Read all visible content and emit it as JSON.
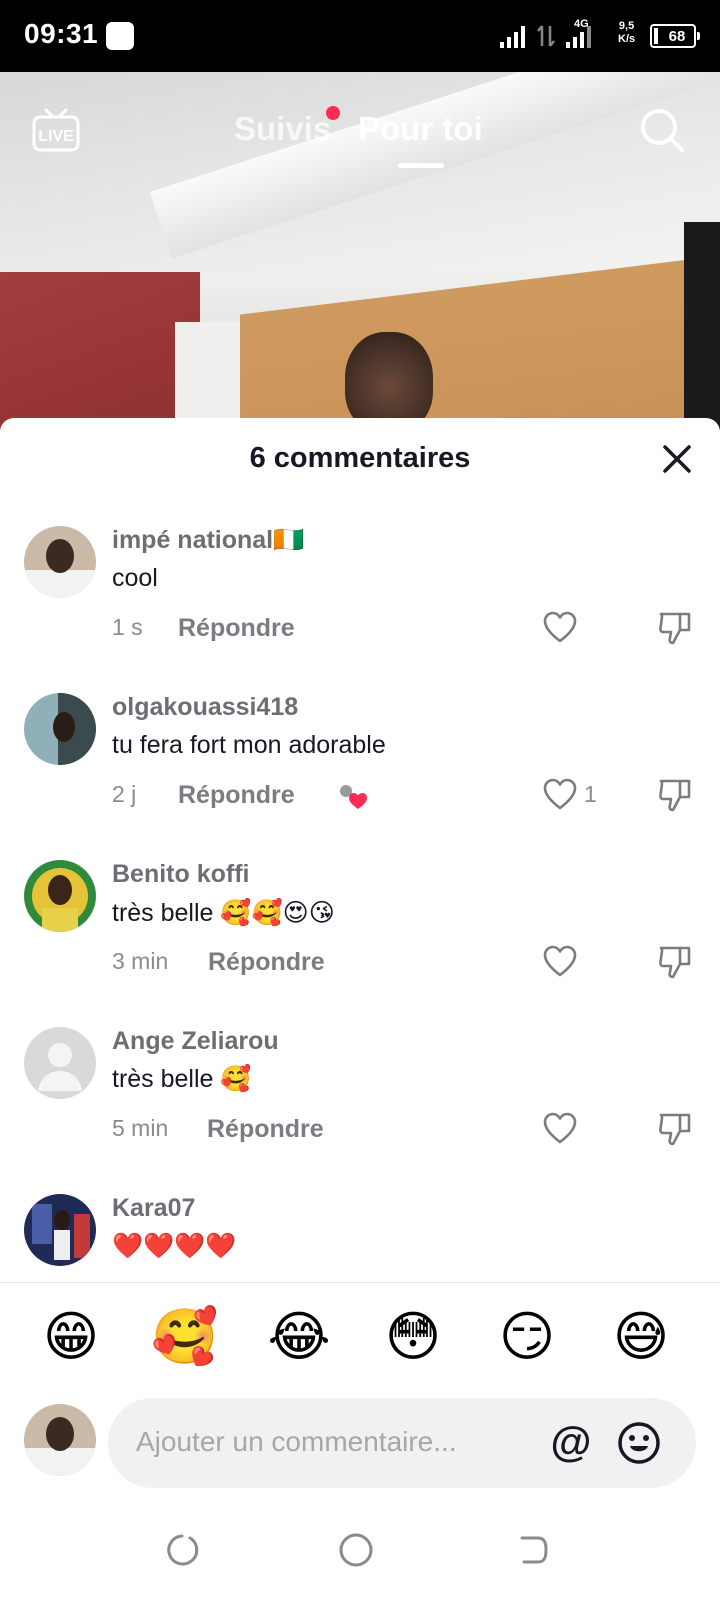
{
  "status_bar": {
    "time": "09:31",
    "network": "4G",
    "speed_value": "9,5",
    "speed_unit": "K/s",
    "battery": "68"
  },
  "top_nav": {
    "live_label": "LIVE",
    "tab_following": "Suivis",
    "tab_for_you": "Pour toi",
    "active_tab": "Pour toi"
  },
  "sheet": {
    "title": "6 commentaires",
    "reply_label": "Répondre",
    "comments": [
      {
        "user": "impé national🇨🇮",
        "text": "cool",
        "time": "1 s",
        "likes": "",
        "creator_liked": false
      },
      {
        "user": "olgakouassi418",
        "text": "tu fera fort mon adorable",
        "time": "2 j",
        "likes": "1",
        "creator_liked": true
      },
      {
        "user": "Benito koffi",
        "text": "très belle 🥰🥰😍😘",
        "time": "3 min",
        "likes": "",
        "creator_liked": false
      },
      {
        "user": "Ange Zeliarou",
        "text": "très belle 🥰",
        "time": "5 min",
        "likes": "",
        "creator_liked": false
      },
      {
        "user": "Kara07",
        "text": "❤️❤️❤️❤️",
        "time": "",
        "likes": "",
        "creator_liked": false
      }
    ]
  },
  "quick_emojis": [
    "😁",
    "🥰",
    "😂",
    "😳",
    "😏",
    "😅"
  ],
  "composer": {
    "placeholder": "Ajouter un commentaire...",
    "mention_symbol": "@"
  },
  "colors": {
    "accent_red": "#fe2c55",
    "text_primary": "#161823",
    "text_secondary": "#8a8b91"
  }
}
